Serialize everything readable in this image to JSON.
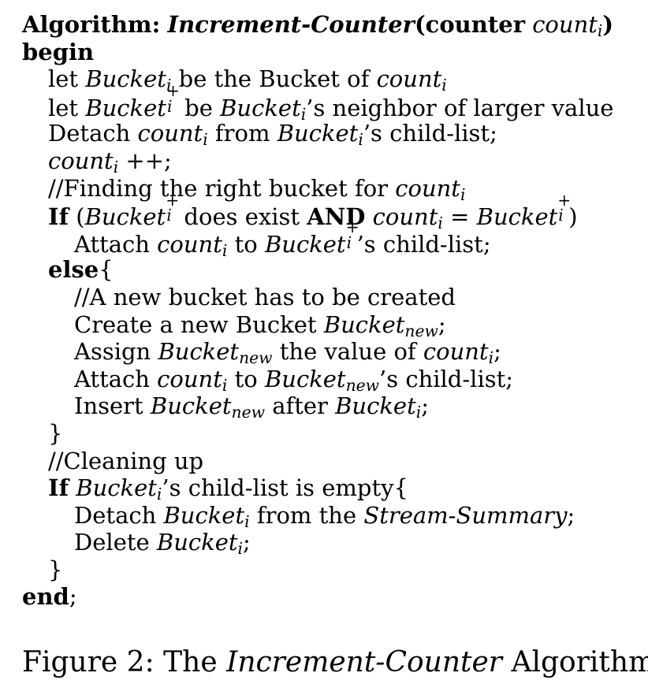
{
  "algorithm": {
    "header": {
      "label": "Algorithm:",
      "name": "Increment-Counter",
      "param_kw": "(counter",
      "param_var": "count",
      "param_sub": "i",
      "param_close": ")"
    },
    "begin": "begin",
    "end": "end",
    "end_punct": ";",
    "l1": {
      "a": "let ",
      "var": "Bucket",
      "sub": "i",
      "b": " be the Bucket of ",
      "var2": "count",
      "sub2": "i"
    },
    "l2": {
      "a": "let ",
      "var": "Bucket",
      "sup": "+",
      "sub": "i",
      "b": " be ",
      "var2": "Bucket",
      "sub2": "i",
      "c": "’s neighbor of larger value"
    },
    "l3": {
      "a": "Detach ",
      "var": "count",
      "sub": "i",
      "b": " from ",
      "var2": "Bucket",
      "sub2": "i",
      "c": "’s child-list;"
    },
    "l4": {
      "var": "count",
      "sub": "i",
      "b": " ++;"
    },
    "l5": {
      "a": "//Finding the right bucket for ",
      "var": "count",
      "sub": "i"
    },
    "l6": {
      "kw": "If",
      "a": " (",
      "var": "Bucket",
      "sup": "+",
      "sub": "i",
      "b": " does exist ",
      "kw2": "AND",
      "c": " ",
      "var2": "count",
      "sub2": "i",
      "d": " = ",
      "var3": "Bucket",
      "sup3": "+",
      "sub3": "i",
      "e": ")"
    },
    "l7": {
      "a": "Attach ",
      "var": "count",
      "sub": "i",
      "b": " to ",
      "var2": "Bucket",
      "sup2": "+",
      "sub2": "i",
      "c": "’s child-list;"
    },
    "l8": {
      "kw": "else",
      "a": "{"
    },
    "l9": {
      "a": "//A new bucket has to be created"
    },
    "l10": {
      "a": "Create a new Bucket ",
      "var": "Bucket",
      "sub": "new",
      "b": ";"
    },
    "l11": {
      "a": "Assign ",
      "var": "Bucket",
      "sub": "new",
      "b": " the value of ",
      "var2": "count",
      "sub2": "i",
      "c": ";"
    },
    "l12": {
      "a": "Attach ",
      "var": "count",
      "sub": "i",
      "b": " to ",
      "var2": "Bucket",
      "sub2": "new",
      "c": "’s child-list;"
    },
    "l13": {
      "a": "Insert ",
      "var": "Bucket",
      "sub": "new",
      "b": " after ",
      "var2": "Bucket",
      "sub2": "i",
      "c": ";"
    },
    "l14": {
      "a": "}"
    },
    "l15": {
      "a": "//Cleaning up"
    },
    "l16": {
      "kw": "If",
      "a": " ",
      "var": "Bucket",
      "sub": "i",
      "b": "’s child-list is empty{"
    },
    "l17": {
      "a": "Detach ",
      "var": "Bucket",
      "sub": "i",
      "b": " from the ",
      "var2": "Stream-Summary",
      "c": ";"
    },
    "l18": {
      "a": "Delete ",
      "var": "Bucket",
      "sub": "i",
      "b": ";"
    },
    "l19": {
      "a": "}"
    }
  },
  "caption": {
    "prefix": "Figure 2: The ",
    "name": "Increment-Counter",
    "suffix": " Algorithm"
  }
}
